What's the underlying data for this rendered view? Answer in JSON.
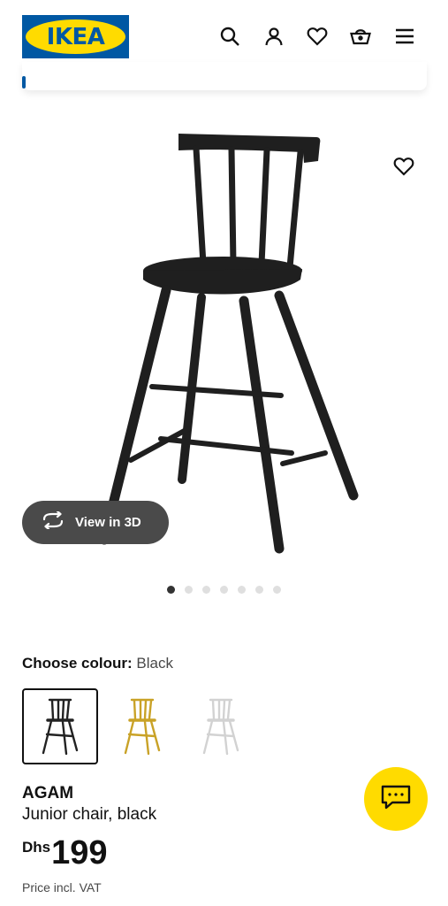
{
  "header": {
    "logo_text": "IKEA",
    "icons": [
      "search-icon",
      "user-icon",
      "heart-icon",
      "basket-icon",
      "menu-icon"
    ]
  },
  "product": {
    "image_dots": {
      "count": 7,
      "active": 0
    },
    "view3d_label": "View in 3D",
    "choose_colour_label": "Choose colour:",
    "selected_colour": "Black",
    "swatches": [
      {
        "colour": "black",
        "hex": "#222222",
        "selected": true
      },
      {
        "colour": "yellow",
        "hex": "#C9A227",
        "selected": false
      },
      {
        "colour": "white",
        "hex": "#E6E6E6",
        "selected": false
      }
    ],
    "name": "AGAM",
    "description": "Junior chair, black",
    "currency": "Dhs",
    "price": "199",
    "price_note": "Price incl. VAT"
  },
  "colors": {
    "brand_blue": "#0058A3",
    "brand_yellow": "#FFDB00",
    "button_dark": "#4a4a4a"
  }
}
